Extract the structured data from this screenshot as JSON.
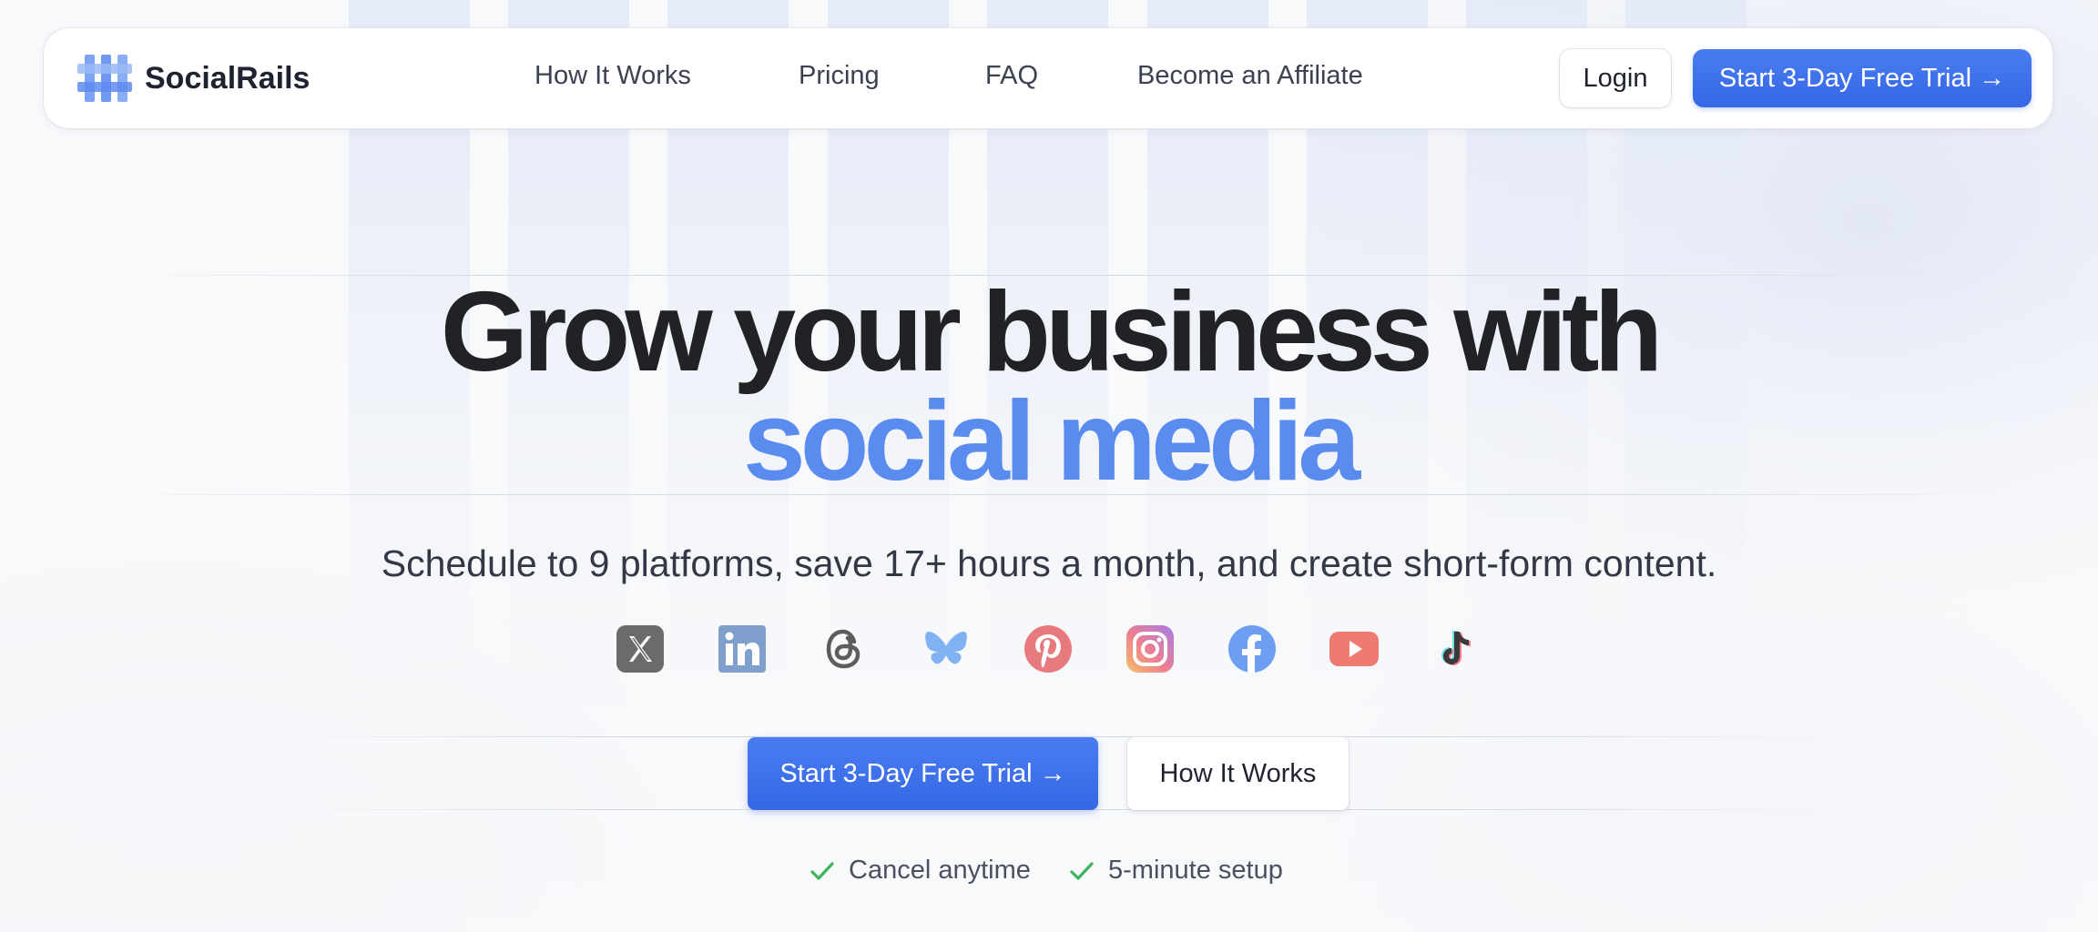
{
  "brand": {
    "name": "SocialRails",
    "logo_icon": "hashtag-grid-icon"
  },
  "nav": {
    "items": [
      {
        "label": "How It Works"
      },
      {
        "label": "Pricing"
      },
      {
        "label": "FAQ"
      },
      {
        "label": "Become an Affiliate"
      }
    ],
    "login_label": "Login",
    "trial_label": "Start 3-Day Free Trial →"
  },
  "hero": {
    "title_line1": "Grow your business with",
    "title_line2": "social media",
    "subtitle": "Schedule to 9 platforms, save 17+ hours a month, and create short-form content.",
    "platforms": [
      {
        "name": "X",
        "icon": "x-icon",
        "color": "#1f1f1f"
      },
      {
        "name": "LinkedIn",
        "icon": "linkedin-icon",
        "color": "#0a66c2"
      },
      {
        "name": "Threads",
        "icon": "threads-icon",
        "color": "#1f1f1f"
      },
      {
        "name": "Bluesky",
        "icon": "bluesky-icon",
        "color": "#4a9af5"
      },
      {
        "name": "Pinterest",
        "icon": "pinterest-icon",
        "color": "#e60023"
      },
      {
        "name": "Instagram",
        "icon": "instagram-icon",
        "color": "#d6249f"
      },
      {
        "name": "Facebook",
        "icon": "facebook-icon",
        "color": "#1877f2"
      },
      {
        "name": "YouTube",
        "icon": "youtube-icon",
        "color": "#ff0000"
      },
      {
        "name": "TikTok",
        "icon": "tiktok-icon",
        "color": "#1f1f1f"
      }
    ],
    "cta_primary": "Start 3-Day Free Trial →",
    "cta_secondary": "How It Works",
    "checks": [
      {
        "label": "Cancel anytime"
      },
      {
        "label": "5-minute setup"
      }
    ]
  },
  "colors": {
    "accent": "#3567e6",
    "highlight": "#5a8cef",
    "check": "#3fb45a"
  }
}
